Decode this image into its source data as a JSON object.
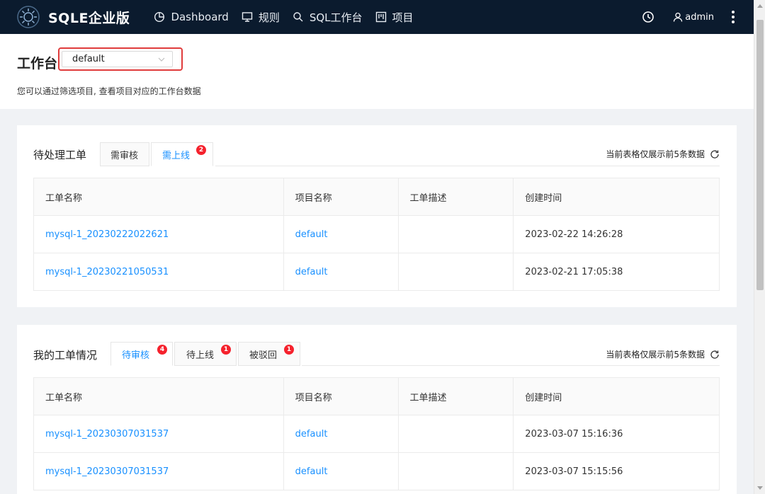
{
  "header": {
    "brand": "SQLE企业版",
    "nav": [
      {
        "icon": "pie-chart-icon",
        "label": "Dashboard"
      },
      {
        "icon": "monitor-icon",
        "label": "规则"
      },
      {
        "icon": "search-icon",
        "label": "SQL工作台"
      },
      {
        "icon": "project-icon",
        "label": "项目"
      }
    ],
    "user": "admin"
  },
  "page": {
    "title": "工作台",
    "project_value": "default",
    "description": "您可以通过筛选项目, 查看项目对应的工作台数据"
  },
  "pending": {
    "title": "待处理工单",
    "tabs": [
      {
        "label": "需审核",
        "badge": "",
        "active": false
      },
      {
        "label": "需上线",
        "badge": "2",
        "active": true
      }
    ],
    "note": "当前表格仅展示前5条数据",
    "columns": [
      "工单名称",
      "项目名称",
      "工单描述",
      "创建时间"
    ],
    "rows": [
      {
        "name": "mysql-1_20230222022621",
        "project": "default",
        "desc": "",
        "time": "2023-02-22 14:26:28"
      },
      {
        "name": "mysql-1_20230221050531",
        "project": "default",
        "desc": "",
        "time": "2023-02-21 17:05:38"
      }
    ]
  },
  "mine": {
    "title": "我的工单情况",
    "tabs": [
      {
        "label": "待审核",
        "badge": "4",
        "active": true
      },
      {
        "label": "待上线",
        "badge": "1",
        "active": false
      },
      {
        "label": "被驳回",
        "badge": "1",
        "active": false
      }
    ],
    "note": "当前表格仅展示前5条数据",
    "columns": [
      "工单名称",
      "项目名称",
      "工单描述",
      "创建时间"
    ],
    "rows": [
      {
        "name": "mysql-1_20230307031537",
        "project": "default",
        "desc": "",
        "time": "2023-03-07 15:16:36"
      },
      {
        "name": "mysql-1_20230307031537",
        "project": "default",
        "desc": "",
        "time": "2023-03-07 15:15:56"
      }
    ]
  },
  "colors": {
    "header_bg": "#0b1b2e",
    "link": "#1890ff",
    "badge": "#f5222d",
    "highlight": "#e03c3c"
  }
}
